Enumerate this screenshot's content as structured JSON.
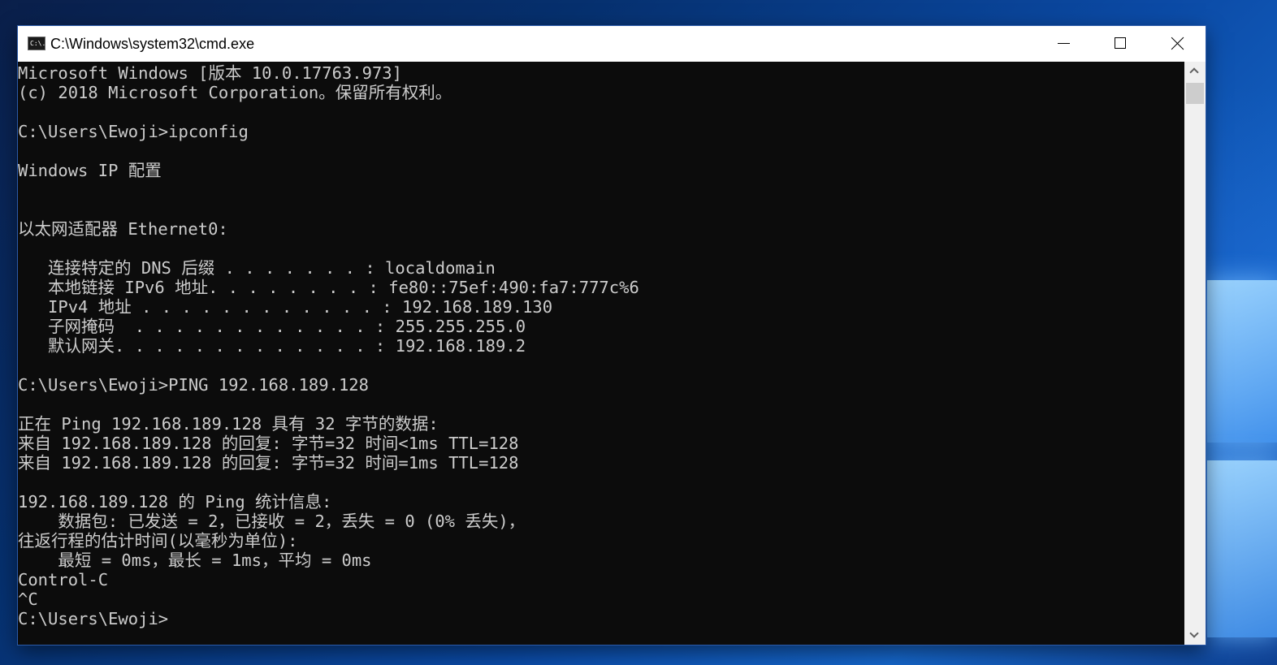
{
  "window": {
    "title": "C:\\Windows\\system32\\cmd.exe",
    "icon": "cmd-icon",
    "icon_text": "C:\\."
  },
  "console": {
    "lines": [
      "Microsoft Windows [版本 10.0.17763.973]",
      "(c) 2018 Microsoft Corporation。保留所有权利。",
      "",
      "C:\\Users\\Ewoji>ipconfig",
      "",
      "Windows IP 配置",
      "",
      "",
      "以太网适配器 Ethernet0:",
      "",
      "   连接特定的 DNS 后缀 . . . . . . . : localdomain",
      "   本地链接 IPv6 地址. . . . . . . . : fe80::75ef:490:fa7:777c%6",
      "   IPv4 地址 . . . . . . . . . . . . : 192.168.189.130",
      "   子网掩码  . . . . . . . . . . . . : 255.255.255.0",
      "   默认网关. . . . . . . . . . . . . : 192.168.189.2",
      "",
      "C:\\Users\\Ewoji>PING 192.168.189.128",
      "",
      "正在 Ping 192.168.189.128 具有 32 字节的数据:",
      "来自 192.168.189.128 的回复: 字节=32 时间<1ms TTL=128",
      "来自 192.168.189.128 的回复: 字节=32 时间=1ms TTL=128",
      "",
      "192.168.189.128 的 Ping 统计信息:",
      "    数据包: 已发送 = 2，已接收 = 2，丢失 = 0 (0% 丢失)，",
      "往返行程的估计时间(以毫秒为单位):",
      "    最短 = 0ms，最长 = 1ms，平均 = 0ms",
      "Control-C",
      "^C",
      "C:\\Users\\Ewoji>"
    ]
  },
  "colors": {
    "console_bg": "#0c0c0c",
    "console_fg": "#cccccc",
    "titlebar_bg": "#ffffff"
  }
}
